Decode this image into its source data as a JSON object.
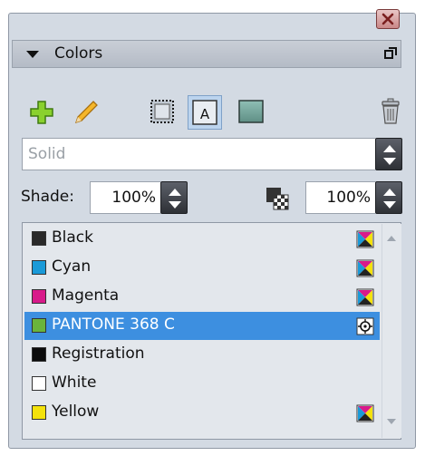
{
  "panel": {
    "title": "Colors"
  },
  "toolbar": {
    "new_swatch_icon": "plus-icon",
    "edit_icon": "pencil-icon",
    "stroke_icon": "stroke-icon",
    "text_icon": "text-icon",
    "fill_icon": "fill-icon",
    "delete_icon": "trash-icon",
    "text_glyph": "A"
  },
  "type_dropdown": {
    "value": "Solid"
  },
  "shade": {
    "label": "Shade:",
    "value": "100%",
    "opacity_value": "100%"
  },
  "colors": [
    {
      "name": "Black",
      "color": "#2a2a2a",
      "mode": "cmyk"
    },
    {
      "name": "Cyan",
      "color": "#1a9ad8",
      "mode": "cmyk"
    },
    {
      "name": "Magenta",
      "color": "#d81a8a",
      "mode": "cmyk"
    },
    {
      "name": "PANTONE 368 C",
      "color": "#6ab43c",
      "mode": "spot",
      "selected": true
    },
    {
      "name": "Registration",
      "color": "#0c0c0c",
      "mode": ""
    },
    {
      "name": "White",
      "color": "#ffffff",
      "mode": ""
    },
    {
      "name": "Yellow",
      "color": "#f4e20c",
      "mode": "cmyk"
    }
  ],
  "accent": {
    "selection": "#3d8fe0",
    "panel_bg": "#d3dae3"
  }
}
